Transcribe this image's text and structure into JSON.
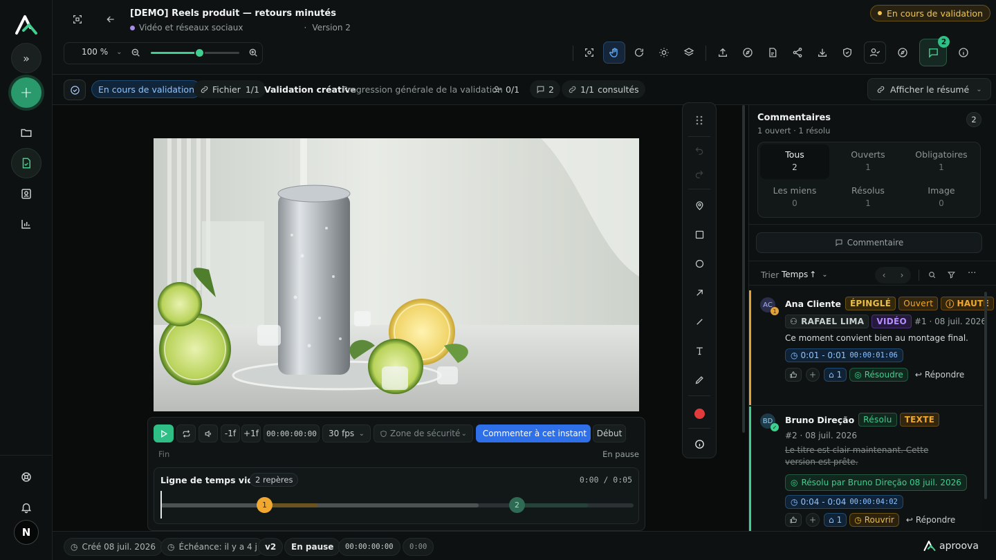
{
  "app": {
    "project_title": "[DEMO] Reels produit — retours minutés",
    "category": "Vidéo et réseaux sociaux",
    "version": "Version 2",
    "status_badge": "En cours de validation",
    "brand": "aproova",
    "user_initial": "N"
  },
  "zoom": {
    "value": "100 %",
    "level": 0.55
  },
  "toolbar": {
    "comments_count": "2"
  },
  "bar2": {
    "status": "En cours de validation",
    "file_label": "Fichier",
    "file_value": "1/1",
    "step_title": "Validation créative",
    "step_desc": "Progression générale de la validation",
    "approvers": "0/1",
    "comments": "2",
    "viewed": "1/1",
    "viewed_label": "consultés",
    "summary_button": "Afficher le résumé"
  },
  "player": {
    "minus_frame": "-1f",
    "plus_frame": "+1f",
    "timecode": "00:00:00:00",
    "fps": "30 fps",
    "safe_zone": "Zone de sécurité",
    "comment_here": "Commenter à cet instant",
    "start": "Début",
    "end": "Fin",
    "state": "En pause",
    "timeline_title": "Ligne de temps vidéo",
    "markers_label": "2 repères",
    "time_display": "0:00 / 0:05",
    "marker1": "1",
    "marker2": "2",
    "progress": 0.0,
    "duration_s": 5
  },
  "panel": {
    "title": "Commentaires",
    "subtitle": "1 ouvert · 1 résolu",
    "count": "2",
    "filters": [
      {
        "label": "Tous",
        "n": "2"
      },
      {
        "label": "Ouverts",
        "n": "1"
      },
      {
        "label": "Obligatoires",
        "n": "1"
      },
      {
        "label": "Les miens",
        "n": "0"
      },
      {
        "label": "Résolus",
        "n": "1"
      },
      {
        "label": "Image",
        "n": "0"
      }
    ],
    "comment_button": "Commentaire",
    "sort_label": "Trier",
    "sort_value": "Temps",
    "comments": [
      {
        "initials": "AC",
        "badge_num": "1",
        "author": "Ana Cliente",
        "tags": [
          "ÉPINGLÉ",
          "Ouvert",
          "HAUTE"
        ],
        "assignee": "RAFAEL LIMA",
        "kind": "VIDÉO",
        "meta": "#1 · 08 juil. 2026",
        "text": "Ce moment convient bien au montage final.",
        "range": "0:01 - 0:01",
        "range_tc": "00:00:01:06",
        "tag_count": "1",
        "action": "Résoudre",
        "reply": "Répondre"
      },
      {
        "initials": "BD",
        "author": "Bruno Direção",
        "tags": [
          "Résolu",
          "TEXTE"
        ],
        "meta": "#2 · 08 juil. 2026",
        "text": "Le titre est clair maintenant. Cette version est prête.",
        "resolved_by": "Résolu par Bruno Direção 08 juil. 2026",
        "range": "0:04 - 0:04",
        "range_tc": "00:00:04:02",
        "tag_count": "1",
        "action": "Rouvrir",
        "reply": "Répondre"
      }
    ]
  },
  "bottom": {
    "created": "Créé 08 juil. 2026",
    "due": "Échéance: il y a 4 j",
    "version": "v2",
    "state": "En pause",
    "tc": "00:00:00:00",
    "short_tc": "0:00"
  },
  "colors": {
    "accent": "#2fbf86",
    "status_amber": "#e0b23a",
    "comment_blue": "#2f6fe8",
    "open_orange": "#e2a23a",
    "resolved_green": "#3fcf8e"
  }
}
